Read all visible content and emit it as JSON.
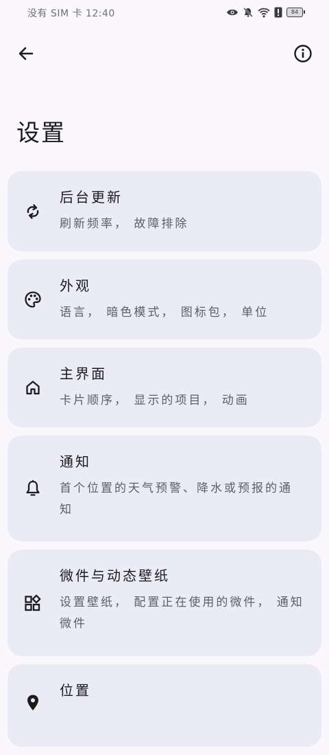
{
  "status_bar": {
    "text": "没有 SIM 卡 12:40",
    "battery": "84",
    "icons": [
      "eye-icon",
      "mute-icon",
      "wifi-icon",
      "alert-icon",
      "battery-icon"
    ]
  },
  "top_bar": {
    "back_icon": "arrow-back-icon",
    "info_icon": "info-icon"
  },
  "page": {
    "title": "设置"
  },
  "settings": {
    "items": [
      {
        "title": "后台更新",
        "subtitle": "刷新频率， 故障排除",
        "icon": "refresh-icon"
      },
      {
        "title": "外观",
        "subtitle": "语言， 暗色模式， 图标包， 单位",
        "icon": "palette-icon"
      },
      {
        "title": "主界面",
        "subtitle": "卡片顺序， 显示的项目， 动画",
        "icon": "home-icon"
      },
      {
        "title": "通知",
        "subtitle": "首个位置的天气预警、降水或预报的通知",
        "icon": "bell-icon"
      },
      {
        "title": "微件与动态壁纸",
        "subtitle": "设置壁纸， 配置正在使用的微件， 通知微件",
        "icon": "widgets-icon"
      },
      {
        "title": "位置",
        "subtitle": "",
        "icon": "location-icon"
      }
    ]
  }
}
